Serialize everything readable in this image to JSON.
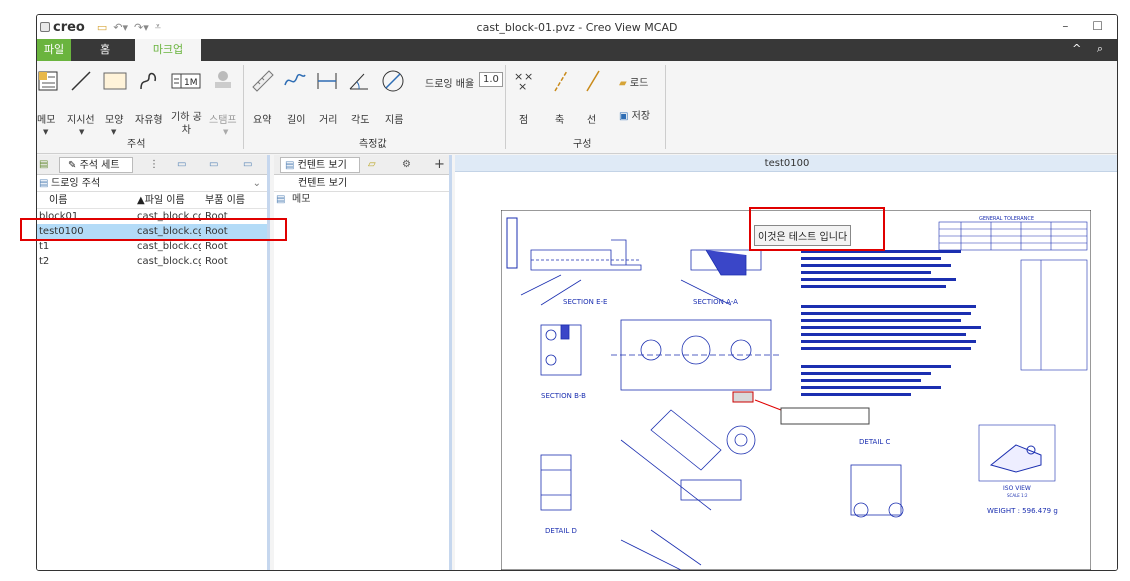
{
  "app": {
    "logo": "creo",
    "title": "cast_block-01.pvz - Creo View MCAD",
    "window_controls": "– ☐"
  },
  "qat_icons": [
    "folder-open-icon",
    "undo-icon",
    "redo-icon",
    "customize-icon"
  ],
  "tabs": [
    "파일",
    "홈",
    "마크업"
  ],
  "tab_right": "^ ⌕",
  "ribbon": {
    "annotation_tools": [
      {
        "label": "메모",
        "has_menu": true
      },
      {
        "label": "지시선",
        "has_menu": true
      },
      {
        "label": "모양",
        "has_menu": true
      },
      {
        "label": "자유형"
      },
      {
        "label": "기하 공\n차"
      },
      {
        "label": "스탬프",
        "has_menu": true,
        "disabled": true
      }
    ],
    "annotation_group": "주석",
    "measure_tools": [
      "요약",
      "길이",
      "거리",
      "각도",
      "지름"
    ],
    "measure_group": "측정값",
    "scale_label": "드로잉 배율",
    "scale_value": "1.0",
    "construct_tools": [
      "점",
      "축",
      "선"
    ],
    "construct_group": "구성",
    "load_label": "로드",
    "save_label": "저장"
  },
  "left_panel": {
    "tab_label": "주석 세트",
    "subheader": "드로잉 주석",
    "columns": [
      "이름",
      "▲파일 이름",
      "부품 이름"
    ],
    "rows": [
      {
        "name": "block01",
        "file": "cast_block.cgr",
        "part": "Root",
        "selected": false
      },
      {
        "name": "test0100",
        "file": "cast_block.cgr",
        "part": "Root",
        "selected": true
      },
      {
        "name": "t1",
        "file": "cast_block.cgr",
        "part": "Root",
        "selected": false
      },
      {
        "name": "t2",
        "file": "cast_block.cgr",
        "part": "Root",
        "selected": false
      }
    ]
  },
  "content_panel": {
    "tab_label": "컨텐트 보기",
    "header": "컨텐트 보기",
    "items": [
      "메모"
    ]
  },
  "viewer": {
    "header": "test0100",
    "callout_text": "이것은 테스트 입니다",
    "drawing_labels": {
      "section_ee": "SECTION E-E",
      "section_aa": "SECTION A-A",
      "section_bb": "SECTION B-B",
      "detail_c": "DETAIL C",
      "detail_d": "DETAIL D",
      "iso_view": "ISO VIEW",
      "scale_iso": "SCALE 1:2",
      "weight": "WEIGHT : 596.479 g",
      "general_tolerance": "GENERAL TOLERANCE"
    }
  },
  "colors": {
    "accent": "#6ab43e",
    "tabbar": "#383838",
    "highlight": "#e00000",
    "selection": "#b3dbf7"
  }
}
